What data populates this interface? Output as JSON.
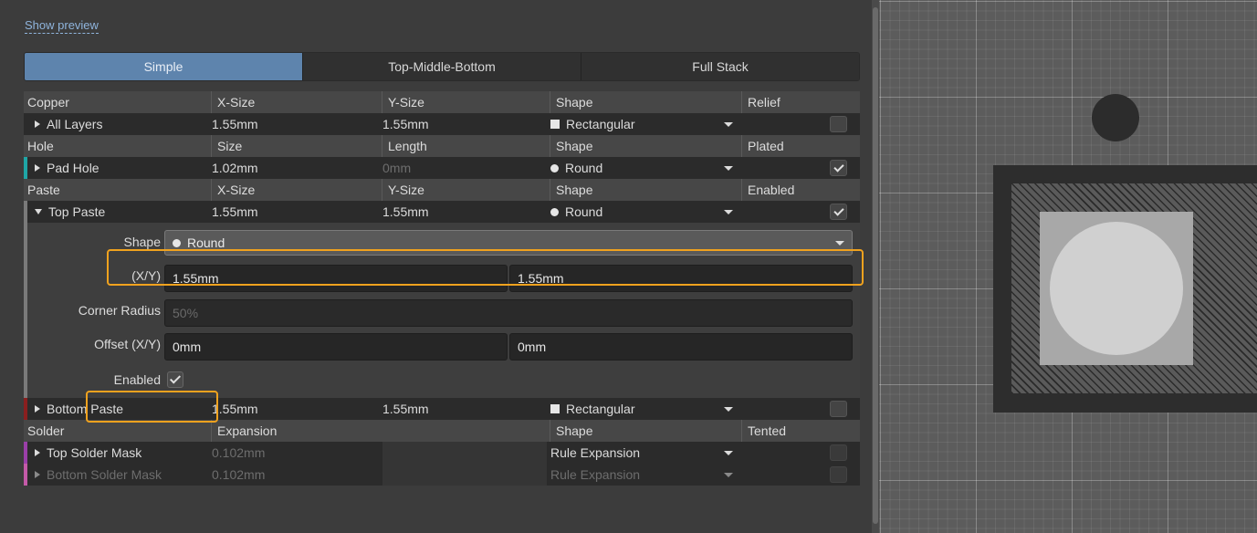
{
  "show_preview": "Show preview",
  "tabs": [
    "Simple",
    "Top-Middle-Bottom",
    "Full Stack"
  ],
  "copper": {
    "headers": [
      "Copper",
      "X-Size",
      "Y-Size",
      "Shape",
      "Relief"
    ],
    "row": {
      "name": "All Layers",
      "x": "1.55mm",
      "y": "1.55mm",
      "shape": "Rectangular",
      "checked": false
    }
  },
  "hole": {
    "headers": [
      "Hole",
      "Size",
      "Length",
      "Shape",
      "Plated"
    ],
    "row": {
      "name": "Pad Hole",
      "x": "1.02mm",
      "y": "0mm",
      "shape": "Round",
      "checked": true,
      "stripe": "#1fa6a6"
    }
  },
  "paste": {
    "headers": [
      "Paste",
      "X-Size",
      "Y-Size",
      "Shape",
      "Enabled"
    ],
    "top": {
      "name": "Top Paste",
      "x": "1.55mm",
      "y": "1.55mm",
      "shape": "Round",
      "checked": true,
      "stripe": "#7a7a7a"
    },
    "editor": {
      "shape_label": "Shape",
      "shape_value": "Round",
      "xy_label": "(X/Y)",
      "x": "1.55mm",
      "y": "1.55mm",
      "corner_label": "Corner Radius",
      "corner": "50%",
      "offset_label": "Offset (X/Y)",
      "offset_x": "0mm",
      "offset_y": "0mm",
      "enabled_label": "Enabled"
    },
    "bottom": {
      "name": "Bottom Paste",
      "x": "1.55mm",
      "y": "1.55mm",
      "shape": "Rectangular",
      "checked": false,
      "stripe": "#8a1f1f"
    }
  },
  "solder": {
    "headers": [
      "Solder",
      "Expansion",
      "",
      "Shape",
      "Tented"
    ],
    "top": {
      "name": "Top Solder Mask",
      "exp": "0.102mm",
      "shape": "Rule Expansion",
      "stripe": "#9a3fa8"
    },
    "bottom": {
      "name": "Bottom Solder Mask",
      "exp": "0.102mm",
      "shape": "Rule Expansion",
      "stripe": "#c45aa8"
    }
  },
  "colors": {
    "accent": "#5e84ad",
    "highlight": "#f0a21e"
  }
}
